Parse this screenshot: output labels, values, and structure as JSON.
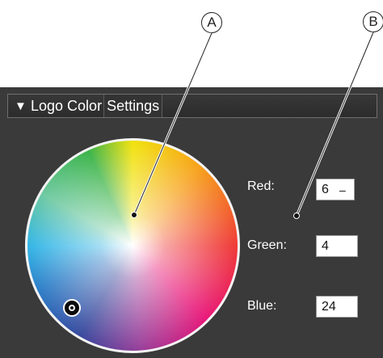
{
  "callouts": {
    "a": "A",
    "b": "B"
  },
  "panel": {
    "collapse_icon": "▼",
    "title_part1": "Logo Color",
    "title_part2": "Settings"
  },
  "color_wheel": {
    "picker_icon": "wheel-picker-icon"
  },
  "fields": {
    "red": {
      "label": "Red:",
      "value": "6",
      "cursor": "–"
    },
    "green": {
      "label": "Green:",
      "value": "4"
    },
    "blue": {
      "label": "Blue:",
      "value": "24"
    }
  },
  "colors": {
    "panel_bg": "#3a3a3a",
    "header_border": "#6f6f6f",
    "label_text": "#ffffff",
    "field_bg": "#ffffff"
  }
}
